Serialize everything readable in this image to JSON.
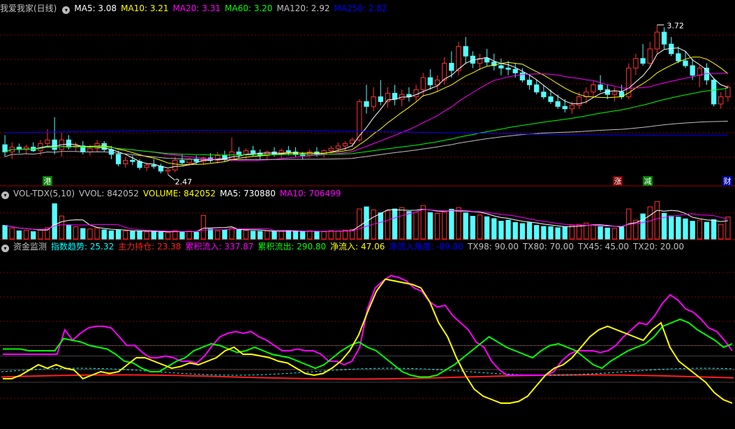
{
  "header1": {
    "title": "我爱我家(日线)",
    "items": [
      {
        "text": "MA5: 3.08",
        "color": "#ffffff"
      },
      {
        "text": "MA10: 3.21",
        "color": "#ffff00"
      },
      {
        "text": "MA20: 3.31",
        "color": "#ff00ff"
      },
      {
        "text": "MA60: 3.20",
        "color": "#00ff00"
      },
      {
        "text": "MA120: 2.92",
        "color": "#c0c0c0"
      },
      {
        "text": "MA250: 2.82",
        "color": "#0000ff"
      }
    ]
  },
  "header2": {
    "title": "VOL-TDX(5,10)",
    "items": [
      {
        "text": "VVOL: 842052",
        "color": "#c0c0c0"
      },
      {
        "text": "VOLUME: 842052",
        "color": "#ffff00"
      },
      {
        "text": "MA5: 730880",
        "color": "#ffffff"
      },
      {
        "text": "MA10: 706499",
        "color": "#ff00ff"
      }
    ]
  },
  "header3": {
    "title": "资金监测",
    "items": [
      {
        "text": "指数趋势: 25.32",
        "color": "#00ffff"
      },
      {
        "text": "主力持仓: 23.38",
        "color": "#ff2020"
      },
      {
        "text": "累积流入: 337.87",
        "color": "#ff00ff"
      },
      {
        "text": "累积流出: 290.80",
        "color": "#00ff00"
      },
      {
        "text": "净流入: 47.06",
        "color": "#ffff00"
      },
      {
        "text": "净流入角度: -89.80",
        "color": "#0000ff"
      },
      {
        "text": "TX98: 90.00",
        "color": "#c0c0c0"
      },
      {
        "text": "TX80: 70.00",
        "color": "#c0c0c0"
      },
      {
        "text": "TX45: 45.00",
        "color": "#c0c0c0"
      },
      {
        "text": "TX20: 20.00",
        "color": "#c0c0c0"
      }
    ]
  },
  "markers": [
    {
      "text": "港",
      "bg": "#008000",
      "fg": "#ffffff",
      "x": 68
    },
    {
      "text": "涨",
      "bg": "#800000",
      "fg": "#ffffff",
      "x": 885
    },
    {
      "text": "减",
      "bg": "#008000",
      "fg": "#ffffff",
      "x": 928
    },
    {
      "text": "财",
      "bg": "#0000a0",
      "fg": "#ffffff",
      "x": 1042
    }
  ],
  "annotations": {
    "high": "3.72",
    "low": "2.47"
  },
  "chart_data": {
    "type": "candlestick",
    "series": "daily",
    "price_range": [
      2.4,
      3.8
    ],
    "ohlc": [
      [
        2.72,
        2.8,
        2.62,
        2.66
      ],
      [
        2.66,
        2.74,
        2.6,
        2.7
      ],
      [
        2.7,
        2.73,
        2.65,
        2.68
      ],
      [
        2.68,
        2.72,
        2.64,
        2.7
      ],
      [
        2.7,
        2.74,
        2.66,
        2.67
      ],
      [
        2.67,
        2.76,
        2.63,
        2.73
      ],
      [
        2.73,
        2.85,
        2.7,
        2.76
      ],
      [
        2.76,
        2.95,
        2.64,
        2.68
      ],
      [
        2.68,
        2.82,
        2.62,
        2.76
      ],
      [
        2.76,
        2.8,
        2.68,
        2.7
      ],
      [
        2.7,
        2.74,
        2.66,
        2.71
      ],
      [
        2.71,
        2.75,
        2.64,
        2.66
      ],
      [
        2.66,
        2.72,
        2.63,
        2.69
      ],
      [
        2.69,
        2.76,
        2.66,
        2.73
      ],
      [
        2.73,
        2.75,
        2.66,
        2.68
      ],
      [
        2.68,
        2.71,
        2.6,
        2.64
      ],
      [
        2.64,
        2.67,
        2.54,
        2.56
      ],
      [
        2.56,
        2.62,
        2.53,
        2.59
      ],
      [
        2.59,
        2.63,
        2.55,
        2.58
      ],
      [
        2.58,
        2.6,
        2.51,
        2.53
      ],
      [
        2.53,
        2.57,
        2.5,
        2.55
      ],
      [
        2.55,
        2.6,
        2.52,
        2.54
      ],
      [
        2.54,
        2.56,
        2.48,
        2.5
      ],
      [
        2.5,
        2.52,
        2.47,
        2.51
      ],
      [
        2.51,
        2.62,
        2.49,
        2.59
      ],
      [
        2.59,
        2.64,
        2.55,
        2.57
      ],
      [
        2.57,
        2.61,
        2.54,
        2.6
      ],
      [
        2.6,
        2.63,
        2.56,
        2.58
      ],
      [
        2.58,
        2.62,
        2.55,
        2.61
      ],
      [
        2.61,
        2.65,
        2.57,
        2.59
      ],
      [
        2.59,
        2.66,
        2.56,
        2.63
      ],
      [
        2.63,
        2.67,
        2.58,
        2.6
      ],
      [
        2.6,
        2.78,
        2.58,
        2.66
      ],
      [
        2.66,
        2.7,
        2.61,
        2.64
      ],
      [
        2.64,
        2.69,
        2.6,
        2.67
      ],
      [
        2.67,
        2.71,
        2.62,
        2.65
      ],
      [
        2.65,
        2.68,
        2.6,
        2.63
      ],
      [
        2.63,
        2.67,
        2.59,
        2.66
      ],
      [
        2.66,
        2.7,
        2.62,
        2.64
      ],
      [
        2.64,
        2.69,
        2.61,
        2.67
      ],
      [
        2.67,
        2.71,
        2.63,
        2.66
      ],
      [
        2.66,
        2.7,
        2.62,
        2.64
      ],
      [
        2.64,
        2.66,
        2.6,
        2.63
      ],
      [
        2.63,
        2.68,
        2.61,
        2.66
      ],
      [
        2.66,
        2.7,
        2.62,
        2.64
      ],
      [
        2.64,
        2.68,
        2.61,
        2.67
      ],
      [
        2.67,
        2.71,
        2.64,
        2.69
      ],
      [
        2.69,
        2.74,
        2.66,
        2.71
      ],
      [
        2.71,
        2.75,
        2.67,
        2.73
      ],
      [
        2.73,
        2.78,
        2.7,
        2.76
      ],
      [
        2.76,
        3.1,
        2.74,
        3.08
      ],
      [
        3.08,
        3.22,
        2.98,
        3.04
      ],
      [
        3.04,
        3.2,
        3.0,
        3.12
      ],
      [
        3.12,
        3.26,
        3.05,
        3.08
      ],
      [
        3.08,
        3.2,
        3.03,
        3.15
      ],
      [
        3.15,
        3.22,
        3.05,
        3.1
      ],
      [
        3.1,
        3.18,
        3.04,
        3.14
      ],
      [
        3.14,
        3.2,
        3.08,
        3.12
      ],
      [
        3.12,
        3.22,
        3.08,
        3.18
      ],
      [
        3.18,
        3.32,
        3.12,
        3.28
      ],
      [
        3.28,
        3.35,
        3.18,
        3.22
      ],
      [
        3.22,
        3.3,
        3.16,
        3.26
      ],
      [
        3.26,
        3.45,
        3.22,
        3.4
      ],
      [
        3.4,
        3.5,
        3.28,
        3.34
      ],
      [
        3.34,
        3.58,
        3.3,
        3.54
      ],
      [
        3.54,
        3.62,
        3.4,
        3.46
      ],
      [
        3.46,
        3.5,
        3.36,
        3.4
      ],
      [
        3.4,
        3.48,
        3.34,
        3.44
      ],
      [
        3.44,
        3.52,
        3.38,
        3.41
      ],
      [
        3.41,
        3.48,
        3.34,
        3.38
      ],
      [
        3.38,
        3.44,
        3.3,
        3.36
      ],
      [
        3.36,
        3.42,
        3.3,
        3.35
      ],
      [
        3.35,
        3.4,
        3.28,
        3.32
      ],
      [
        3.32,
        3.36,
        3.24,
        3.26
      ],
      [
        3.26,
        3.3,
        3.18,
        3.22
      ],
      [
        3.22,
        3.26,
        3.14,
        3.16
      ],
      [
        3.16,
        3.22,
        3.1,
        3.12
      ],
      [
        3.12,
        3.18,
        3.06,
        3.08
      ],
      [
        3.08,
        3.14,
        3.02,
        3.04
      ],
      [
        3.04,
        3.1,
        2.99,
        3.02
      ],
      [
        3.02,
        3.08,
        2.98,
        3.05
      ],
      [
        3.05,
        3.16,
        3.02,
        3.12
      ],
      [
        3.12,
        3.2,
        3.06,
        3.16
      ],
      [
        3.16,
        3.25,
        3.12,
        3.22
      ],
      [
        3.22,
        3.3,
        3.16,
        3.18
      ],
      [
        3.18,
        3.22,
        3.1,
        3.14
      ],
      [
        3.14,
        3.2,
        3.08,
        3.16
      ],
      [
        3.16,
        3.22,
        3.1,
        3.12
      ],
      [
        3.12,
        3.4,
        3.1,
        3.36
      ],
      [
        3.36,
        3.48,
        3.3,
        3.44
      ],
      [
        3.44,
        3.56,
        3.38,
        3.4
      ],
      [
        3.4,
        3.58,
        3.36,
        3.52
      ],
      [
        3.52,
        3.72,
        3.48,
        3.66
      ],
      [
        3.66,
        3.7,
        3.52,
        3.56
      ],
      [
        3.56,
        3.62,
        3.46,
        3.48
      ],
      [
        3.48,
        3.54,
        3.4,
        3.42
      ],
      [
        3.42,
        3.5,
        3.36,
        3.38
      ],
      [
        3.38,
        3.44,
        3.26,
        3.3
      ],
      [
        3.3,
        3.38,
        3.2,
        3.36
      ],
      [
        3.36,
        3.4,
        3.22,
        3.26
      ],
      [
        3.26,
        3.28,
        3.04,
        3.06
      ],
      [
        3.06,
        3.16,
        3.02,
        3.12
      ],
      [
        3.12,
        3.22,
        3.08,
        3.2
      ]
    ],
    "volume_range": [
      0,
      1500000
    ],
    "volume": [
      520000,
      420000,
      310000,
      330000,
      280000,
      360000,
      430000,
      1350000,
      880000,
      540000,
      470000,
      400000,
      380000,
      420000,
      350000,
      310000,
      330000,
      300000,
      290000,
      310000,
      270000,
      290000,
      260000,
      250000,
      320000,
      280000,
      300000,
      260000,
      900000,
      380000,
      310000,
      340000,
      420000,
      360000,
      330000,
      300000,
      290000,
      310000,
      280000,
      300000,
      330000,
      290000,
      270000,
      310000,
      290000,
      280000,
      320000,
      300000,
      340000,
      360000,
      1150000,
      1230000,
      1120000,
      1000000,
      1080000,
      1150000,
      1200000,
      1050000,
      1020000,
      1280000,
      1010000,
      980000,
      1020000,
      1140000,
      1200000,
      1000000,
      870000,
      920000,
      850000,
      780000,
      680000,
      720000,
      630000,
      590000,
      620000,
      520000,
      480000,
      470000,
      430000,
      460000,
      520000,
      560000,
      610000,
      540000,
      470000,
      420000,
      400000,
      450000,
      1150000,
      720000,
      960000,
      1230000,
      1430000,
      980000,
      880000,
      840000,
      770000,
      680000,
      720000,
      640000,
      740000,
      560000,
      842052
    ],
    "lines": [
      {
        "name": "累积流入",
        "color": "#ff00ff",
        "values": [
          42,
          42,
          42,
          42,
          42,
          42,
          42,
          42,
          56,
          50,
          54,
          57,
          58,
          58,
          57,
          52,
          47,
          47,
          43,
          40,
          40,
          41,
          40,
          38,
          38,
          37,
          41,
          47,
          52,
          54,
          55,
          54,
          55,
          52,
          50,
          47,
          44,
          44,
          45,
          44,
          44,
          42,
          38,
          38,
          36,
          38,
          46,
          68,
          80,
          84,
          87,
          86,
          84,
          80,
          78,
          72,
          69,
          70,
          64,
          60,
          56,
          49,
          46,
          38,
          33,
          30,
          30,
          30,
          30,
          30,
          30,
          32,
          38,
          42,
          44,
          44,
          44,
          43,
          44,
          47,
          52,
          56,
          60,
          59,
          64,
          71,
          76,
          73,
          68,
          66,
          62,
          57,
          55,
          50,
          44
        ]
      },
      {
        "name": "累积流出",
        "color": "#00ff00",
        "values": [
          45,
          45,
          45,
          44,
          44,
          44,
          44,
          51,
          50,
          49,
          47,
          46,
          45,
          42,
          38,
          37,
          34,
          32,
          32,
          35,
          38,
          40,
          44,
          46,
          48,
          47,
          45,
          43,
          44,
          46,
          44,
          42,
          41,
          40,
          38,
          36,
          34,
          36,
          40,
          44,
          47,
          49,
          46,
          44,
          40,
          36,
          32,
          30,
          29,
          29,
          30,
          33,
          36,
          40,
          44,
          48,
          52,
          49,
          46,
          44,
          42,
          40,
          44,
          47,
          48,
          46,
          44,
          40,
          36,
          34,
          38,
          41,
          44,
          46,
          48,
          52,
          58,
          60,
          62,
          60,
          56,
          53,
          50,
          46,
          48
        ]
      },
      {
        "name": "净流入",
        "color": "#ffff00",
        "values": [
          28,
          28,
          30,
          33,
          36,
          34,
          36,
          34,
          33,
          28,
          30,
          32,
          31,
          32,
          36,
          40,
          40,
          38,
          36,
          34,
          35,
          37,
          36,
          38,
          40,
          44,
          46,
          42,
          42,
          41,
          40,
          38,
          37,
          34,
          31,
          30,
          31,
          34,
          38,
          44,
          53,
          66,
          78,
          85,
          84,
          83,
          82,
          80,
          72,
          60,
          52,
          40,
          30,
          22,
          18,
          16,
          14,
          14,
          15,
          18,
          24,
          30,
          34,
          36,
          40,
          46,
          52,
          56,
          58,
          56,
          54,
          52,
          50,
          56,
          60,
          46,
          38,
          34,
          30,
          26,
          20,
          16,
          14
        ]
      }
    ],
    "ref_lines": [
      20,
      45,
      70,
      90
    ]
  }
}
